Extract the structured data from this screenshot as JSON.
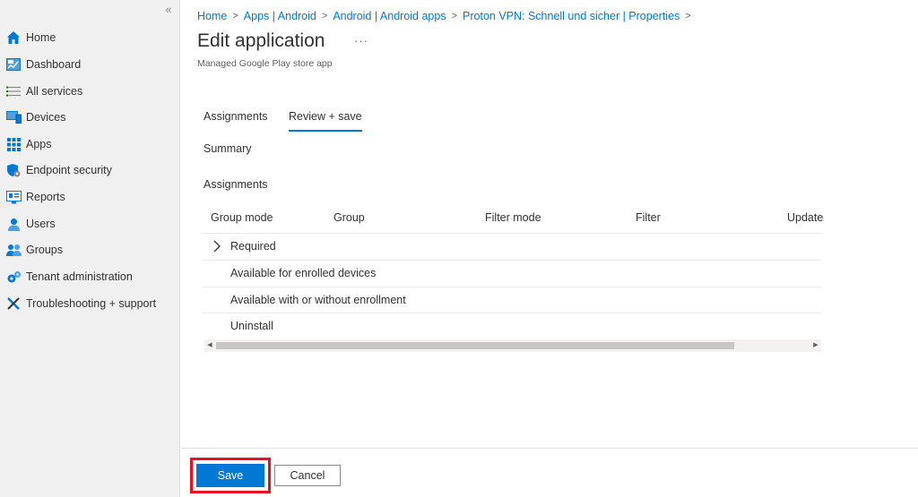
{
  "sidebar": {
    "collapse_glyph": "«",
    "items": [
      {
        "label": "Home",
        "icon": "home-icon"
      },
      {
        "label": "Dashboard",
        "icon": "dashboard-icon"
      },
      {
        "label": "All services",
        "icon": "list-icon"
      },
      {
        "label": "Devices",
        "icon": "devices-icon"
      },
      {
        "label": "Apps",
        "icon": "apps-grid-icon"
      },
      {
        "label": "Endpoint security",
        "icon": "shield-icon"
      },
      {
        "label": "Reports",
        "icon": "reports-icon"
      },
      {
        "label": "Users",
        "icon": "user-icon"
      },
      {
        "label": "Groups",
        "icon": "groups-icon"
      },
      {
        "label": "Tenant administration",
        "icon": "tenant-admin-icon"
      },
      {
        "label": "Troubleshooting + support",
        "icon": "tools-icon"
      }
    ]
  },
  "breadcrumb": {
    "items": [
      "Home",
      "Apps | Android",
      "Android | Android apps",
      "Proton VPN: Schnell und sicher | Properties"
    ],
    "separator": ">"
  },
  "header": {
    "title": "Edit application",
    "more": "···",
    "subtitle": "Managed Google Play store app"
  },
  "tabs": [
    {
      "label": "Assignments",
      "active": false
    },
    {
      "label": "Review + save",
      "active": true
    }
  ],
  "sections": {
    "summary": "Summary",
    "assignments": "Assignments"
  },
  "grid": {
    "columns": [
      "Group mode",
      "Group",
      "Filter mode",
      "Filter",
      "Update"
    ],
    "rows": [
      "Required",
      "Available for enrolled devices",
      "Available with or without enrollment",
      "Uninstall"
    ]
  },
  "footer": {
    "save_label": "Save",
    "cancel_label": "Cancel"
  },
  "colors": {
    "accent": "#0078d4",
    "highlight": "#e81123",
    "sidebar_bg": "#f0f0f0"
  }
}
